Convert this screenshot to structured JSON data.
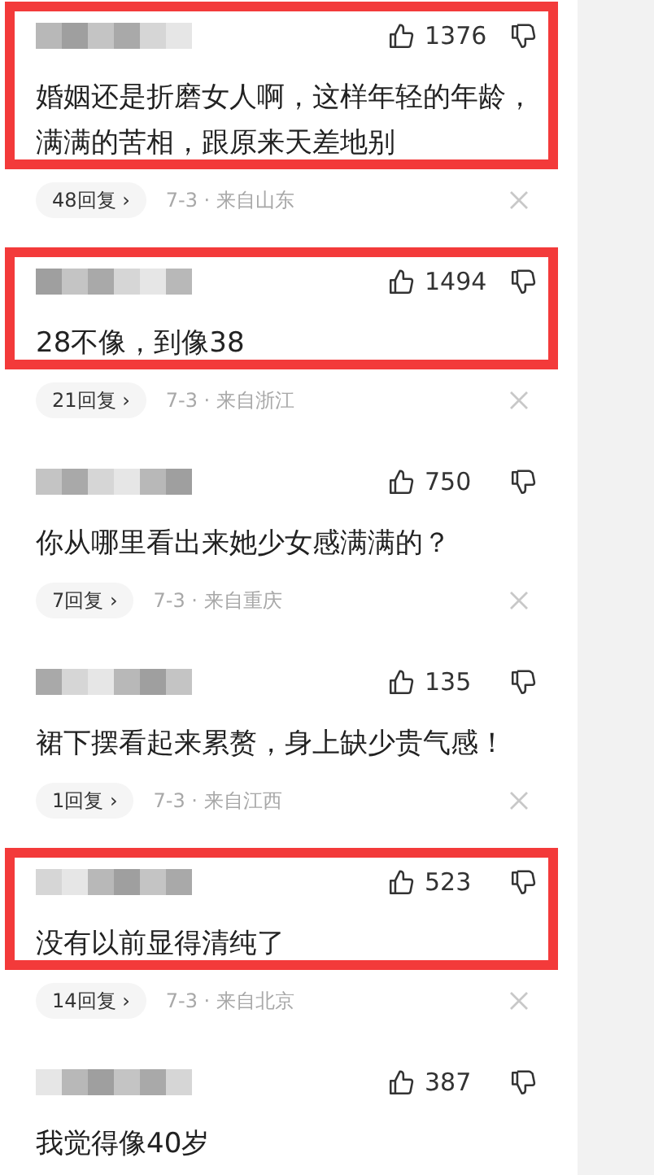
{
  "comments": [
    {
      "likes": "1376",
      "text": "婚姻还是折磨女人啊，这样年轻的年龄，满满的苦相，跟原来天差地别",
      "replies": "48回复 ›",
      "meta": "7-3 · 来自山东",
      "highlighted": true
    },
    {
      "likes": "1494",
      "text": "28不像，到像38",
      "replies": "21回复 ›",
      "meta": "7-3 · 来自浙江",
      "highlighted": true
    },
    {
      "likes": "750",
      "text": "你从哪里看出来她少女感满满的？",
      "replies": "7回复 ›",
      "meta": "7-3 · 来自重庆",
      "highlighted": false
    },
    {
      "likes": "135",
      "text": "裙下摆看起来累赘，身上缺少贵气感！",
      "replies": "1回复 ›",
      "meta": "7-3 · 来自江西",
      "highlighted": false
    },
    {
      "likes": "523",
      "text": "没有以前显得清纯了",
      "replies": "14回复 ›",
      "meta": "7-3 · 来自北京",
      "highlighted": true
    },
    {
      "likes": "387",
      "text": "我觉得像40岁",
      "highlighted": false
    }
  ]
}
